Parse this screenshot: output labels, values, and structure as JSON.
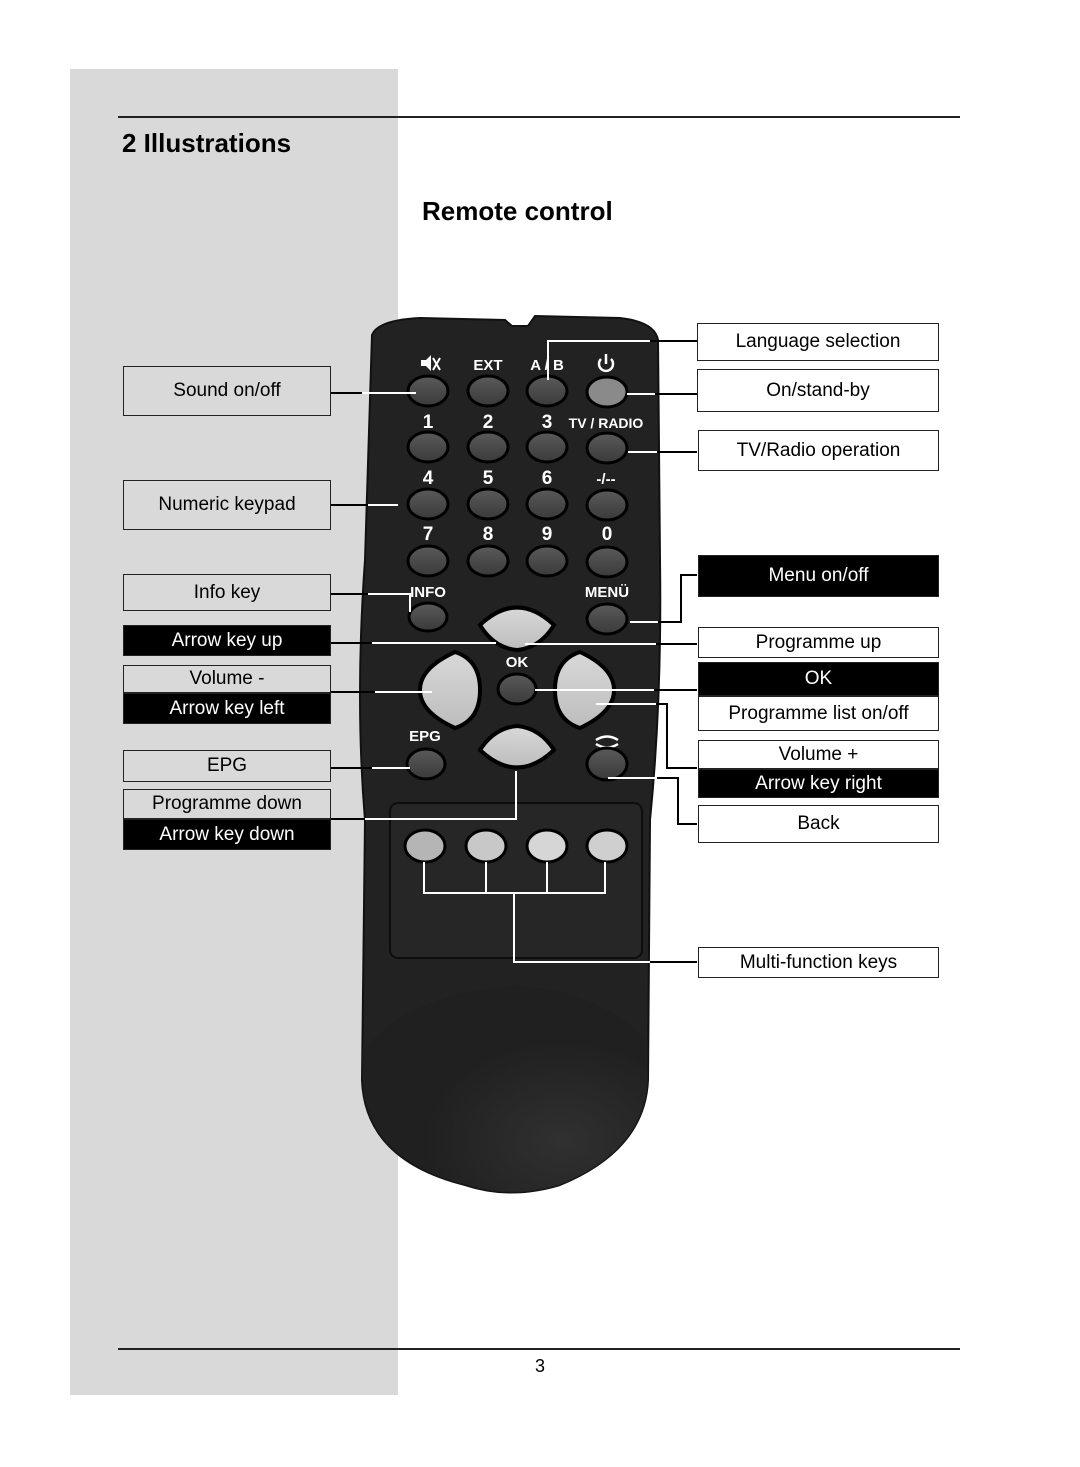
{
  "header": {
    "section_title": "2 Illustrations",
    "subtitle": "Remote control"
  },
  "footer": {
    "page_number": "3"
  },
  "remote": {
    "top_row": [
      "mute-icon",
      "EXT",
      "A/B",
      "power-icon"
    ],
    "top_row_labels": {
      "ext": "EXT",
      "ab": "A / B",
      "tv_radio": "TV / RADIO",
      "plus_minus": "-/--",
      "info": "INFO",
      "menu": "MENÜ",
      "ok": "OK",
      "epg": "EPG"
    },
    "digits": [
      "1",
      "2",
      "3",
      "4",
      "5",
      "6",
      "7",
      "8",
      "9",
      "0"
    ]
  },
  "callouts": {
    "left": {
      "sound": "Sound on/off",
      "numeric": "Numeric keypad",
      "info": "Info key",
      "arrow_up": "Arrow key up",
      "volume_minus": "Volume -",
      "arrow_left": "Arrow key left",
      "epg": "EPG",
      "programme_down": "Programme down",
      "arrow_down": "Arrow key down"
    },
    "right": {
      "language": "Language selection",
      "standby": "On/stand-by",
      "tv_radio": "TV/Radio operation",
      "menu": "Menu on/off",
      "programme_up": "Programme up",
      "ok": "OK",
      "programme_list": "Programme list on/off",
      "volume_plus": "Volume +",
      "arrow_right": "Arrow key right",
      "back": "Back",
      "multi_function": "Multi-function keys"
    }
  }
}
